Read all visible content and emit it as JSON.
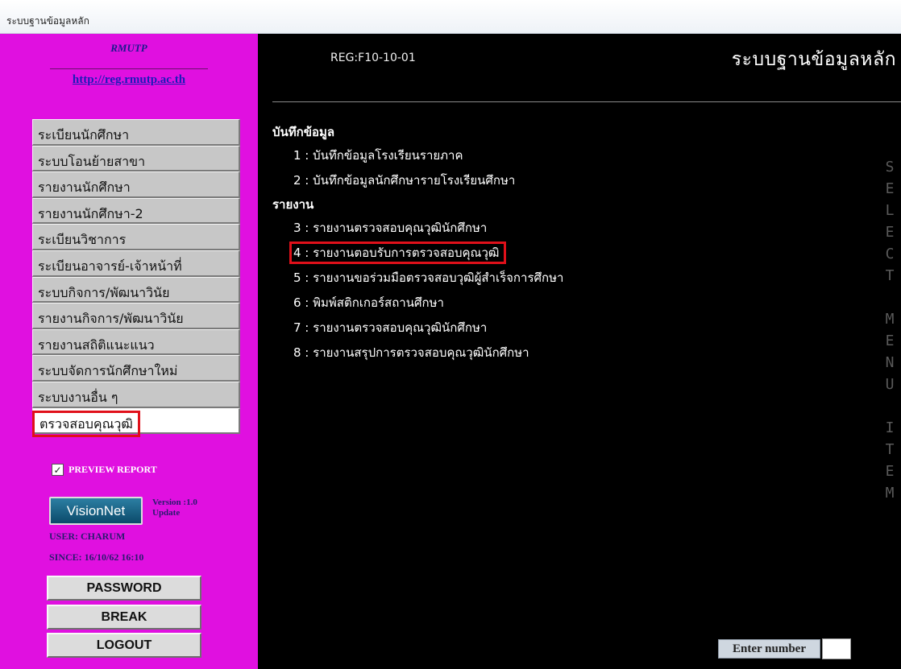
{
  "window": {
    "title": "ระบบฐานข้อมูลหลัก"
  },
  "sidebar": {
    "brand": "RMUTP",
    "link": "http://reg.rmutp.ac.th",
    "menu": [
      {
        "label": "ระเบียนนักศึกษา"
      },
      {
        "label": "ระบบโอนย้ายสาขา"
      },
      {
        "label": "รายงานนักศึกษา"
      },
      {
        "label": "รายงานนักศึกษา-2"
      },
      {
        "label": "ระเบียนวิชาการ"
      },
      {
        "label": "ระเบียนอาจารย์-เจ้าหน้าที่"
      },
      {
        "label": "ระบบกิจการ/พัฒนาวินัย"
      },
      {
        "label": "รายงานกิจการ/พัฒนาวินัย"
      },
      {
        "label": "รายงานสถิติแนะแนว"
      },
      {
        "label": "ระบบจัดการนักศึกษาใหม่"
      },
      {
        "label": "ระบบงานอื่น ๆ"
      },
      {
        "label": "ตรวจสอบคุณวุฒิ",
        "selected": true
      }
    ],
    "preview_report": {
      "label": "PREVIEW REPORT",
      "checked": true,
      "mark": "✓"
    },
    "logo": "VisionNet",
    "version": "Version :1.0",
    "update": "Update",
    "user": "USER: CHARUM",
    "since": "SINCE: 16/10/62 16:10",
    "buttons": {
      "password": "PASSWORD",
      "break": "BREAK",
      "logout": "LOGOUT"
    }
  },
  "main": {
    "code": "REG:F10-10-01",
    "title": "ระบบฐานข้อมูลหลัก",
    "sections": [
      {
        "heading": "บันทึกข้อมูล",
        "items": [
          {
            "text": "1 : บันทึกข้อมูลโรงเรียนรายภาค"
          },
          {
            "text": "2 : บันทึกข้อมูลนักศึกษารายโรงเรียนศึกษา"
          }
        ]
      },
      {
        "heading": "รายงาน",
        "items": [
          {
            "text": "3 : รายงานตรวจสอบคุณวุฒินักศึกษา"
          },
          {
            "text": "4 : รายงานตอบรับการตรวจสอบคุณวุฒิ",
            "highlighted": true
          },
          {
            "text": "5 : รายงานขอร่วมมือตรวจสอบวุฒิผู้สำเร็จการศึกษา"
          },
          {
            "text": "6 : พิมพ์สติกเกอร์สถานศึกษา"
          },
          {
            "text": "7 : รายงานตรวจสอบคุณวุฒินักศึกษา"
          },
          {
            "text": "8 : รายงานสรุปการตรวจสอบคุณวุฒินักศึกษา"
          }
        ]
      }
    ],
    "vertical_label": [
      "S",
      "E",
      "L",
      "E",
      "C",
      "T",
      "",
      "M",
      "E",
      "N",
      "U",
      "",
      "I",
      "T",
      "E",
      "M"
    ],
    "enter_number": {
      "label": "Enter number",
      "value": ""
    }
  },
  "colors": {
    "sidebar_bg": "#e010e0",
    "main_bg": "#000000",
    "highlight": "#e0101a"
  }
}
